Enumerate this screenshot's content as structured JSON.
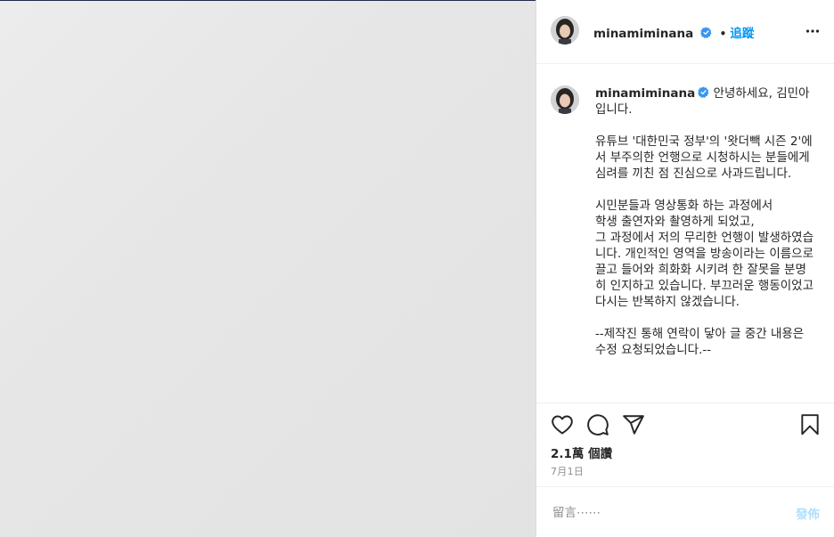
{
  "post": {
    "username": "minamiminana",
    "verified": true,
    "follow_dot": "•",
    "follow_label": "追蹤",
    "more_icon": "more-horizontal-icon",
    "caption_username": "minamiminana",
    "caption_text": "안녕하세요, 김민아\n입니다.\n\n유튜브 '대한민국 정부'의 '왓더빽 시즌 2'에서 부주의한 언행으로 시청하시는 분들에게 심려를 끼친 점 진심으로 사과드립니다.\n\n시민분들과 영상통화 하는 과정에서\n학생 출연자와 촬영하게 되었고,\n그 과정에서 저의 무리한 언행이 발생하였습니다. 개인적인 영역을 방송이라는 이름으로 끌고 들어와 희화화 시키려 한 잘못을 분명히 인지하고 있습니다. 부끄러운 행동이었고 다시는 반복하지 않겠습니다.\n\n--제작진 통해 연락이 닿아 글 중간 내용은 수정 요청되었습니다.--",
    "views": "2.1萬 個讚",
    "date": "7月1日",
    "comment_placeholder": "留言⋯⋯",
    "post_button": "發佈"
  },
  "actions": {
    "like_icon": "heart-icon",
    "comment_icon": "comment-icon",
    "share_icon": "send-icon",
    "save_icon": "bookmark-icon"
  },
  "colors": {
    "accent": "#0095f6",
    "post_disabled": "#b2dffc",
    "media_bg": "#e6e6e6",
    "text": "#262626",
    "muted": "#8e8e8e"
  }
}
